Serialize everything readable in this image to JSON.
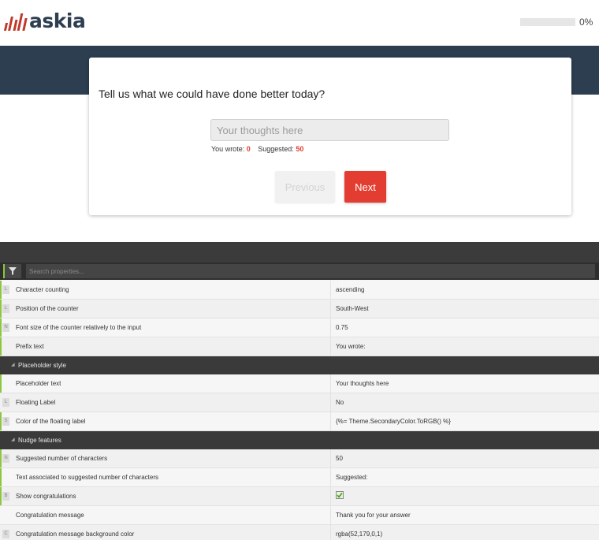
{
  "header": {
    "logo_text": "askia",
    "progress_label": "0%",
    "progress_value": 0
  },
  "survey": {
    "question": "Tell us what we could have done better today?",
    "input_placeholder": "Your thoughts here",
    "input_value": "",
    "counter": {
      "prefix": "You wrote:",
      "count": "0",
      "suggested_label": "Suggested:",
      "suggested_count": "50"
    },
    "previous_label": "Previous",
    "next_label": "Next"
  },
  "panel": {
    "search_placeholder": "Search properties...",
    "rows": [
      {
        "type": "row",
        "badge": "L",
        "label": "Character counting",
        "value": "ascending"
      },
      {
        "type": "row",
        "badge": "L",
        "label": "Position of the counter",
        "value": "South-West"
      },
      {
        "type": "row",
        "badge": "N",
        "label": "Font size of the counter relatively to the input",
        "value": "0.75"
      },
      {
        "type": "row",
        "badge": "",
        "label": "Prefix text",
        "value": "You wrote:"
      },
      {
        "type": "section",
        "label": "Placeholder style"
      },
      {
        "type": "row",
        "badge": "",
        "label": "Placeholder text",
        "value": "Your thoughts here"
      },
      {
        "type": "row",
        "badge": "L",
        "label": "Floating Label",
        "value": "No"
      },
      {
        "type": "row",
        "badge": "S",
        "label": "Color of the floating label",
        "value": "{%= Theme.SecondaryColor.ToRGB() %}"
      },
      {
        "type": "section",
        "label": "Nudge features"
      },
      {
        "type": "row",
        "badge": "N",
        "label": "Suggested number of characters",
        "value": "50"
      },
      {
        "type": "row",
        "badge": "",
        "label": "Text associated to suggested number of characters",
        "value": "Suggested:"
      },
      {
        "type": "row",
        "badge": "B",
        "label": "Show congratulations",
        "value": "",
        "checked": true
      },
      {
        "type": "row",
        "badge": "",
        "label": "Congratulation message",
        "value": "Thank you for your answer"
      },
      {
        "type": "row",
        "badge": "C",
        "label": "Congratulation message background color",
        "value": "rgba(52,179,0,1)"
      }
    ]
  },
  "colors": {
    "accent_red": "#e23d30",
    "header_band": "#2c3e50",
    "panel_green": "#8dc63f",
    "panel_dark": "#3a3a3a"
  },
  "icons": [
    "filter-icon",
    "checkbox-check-icon",
    "caret-down-icon"
  ]
}
